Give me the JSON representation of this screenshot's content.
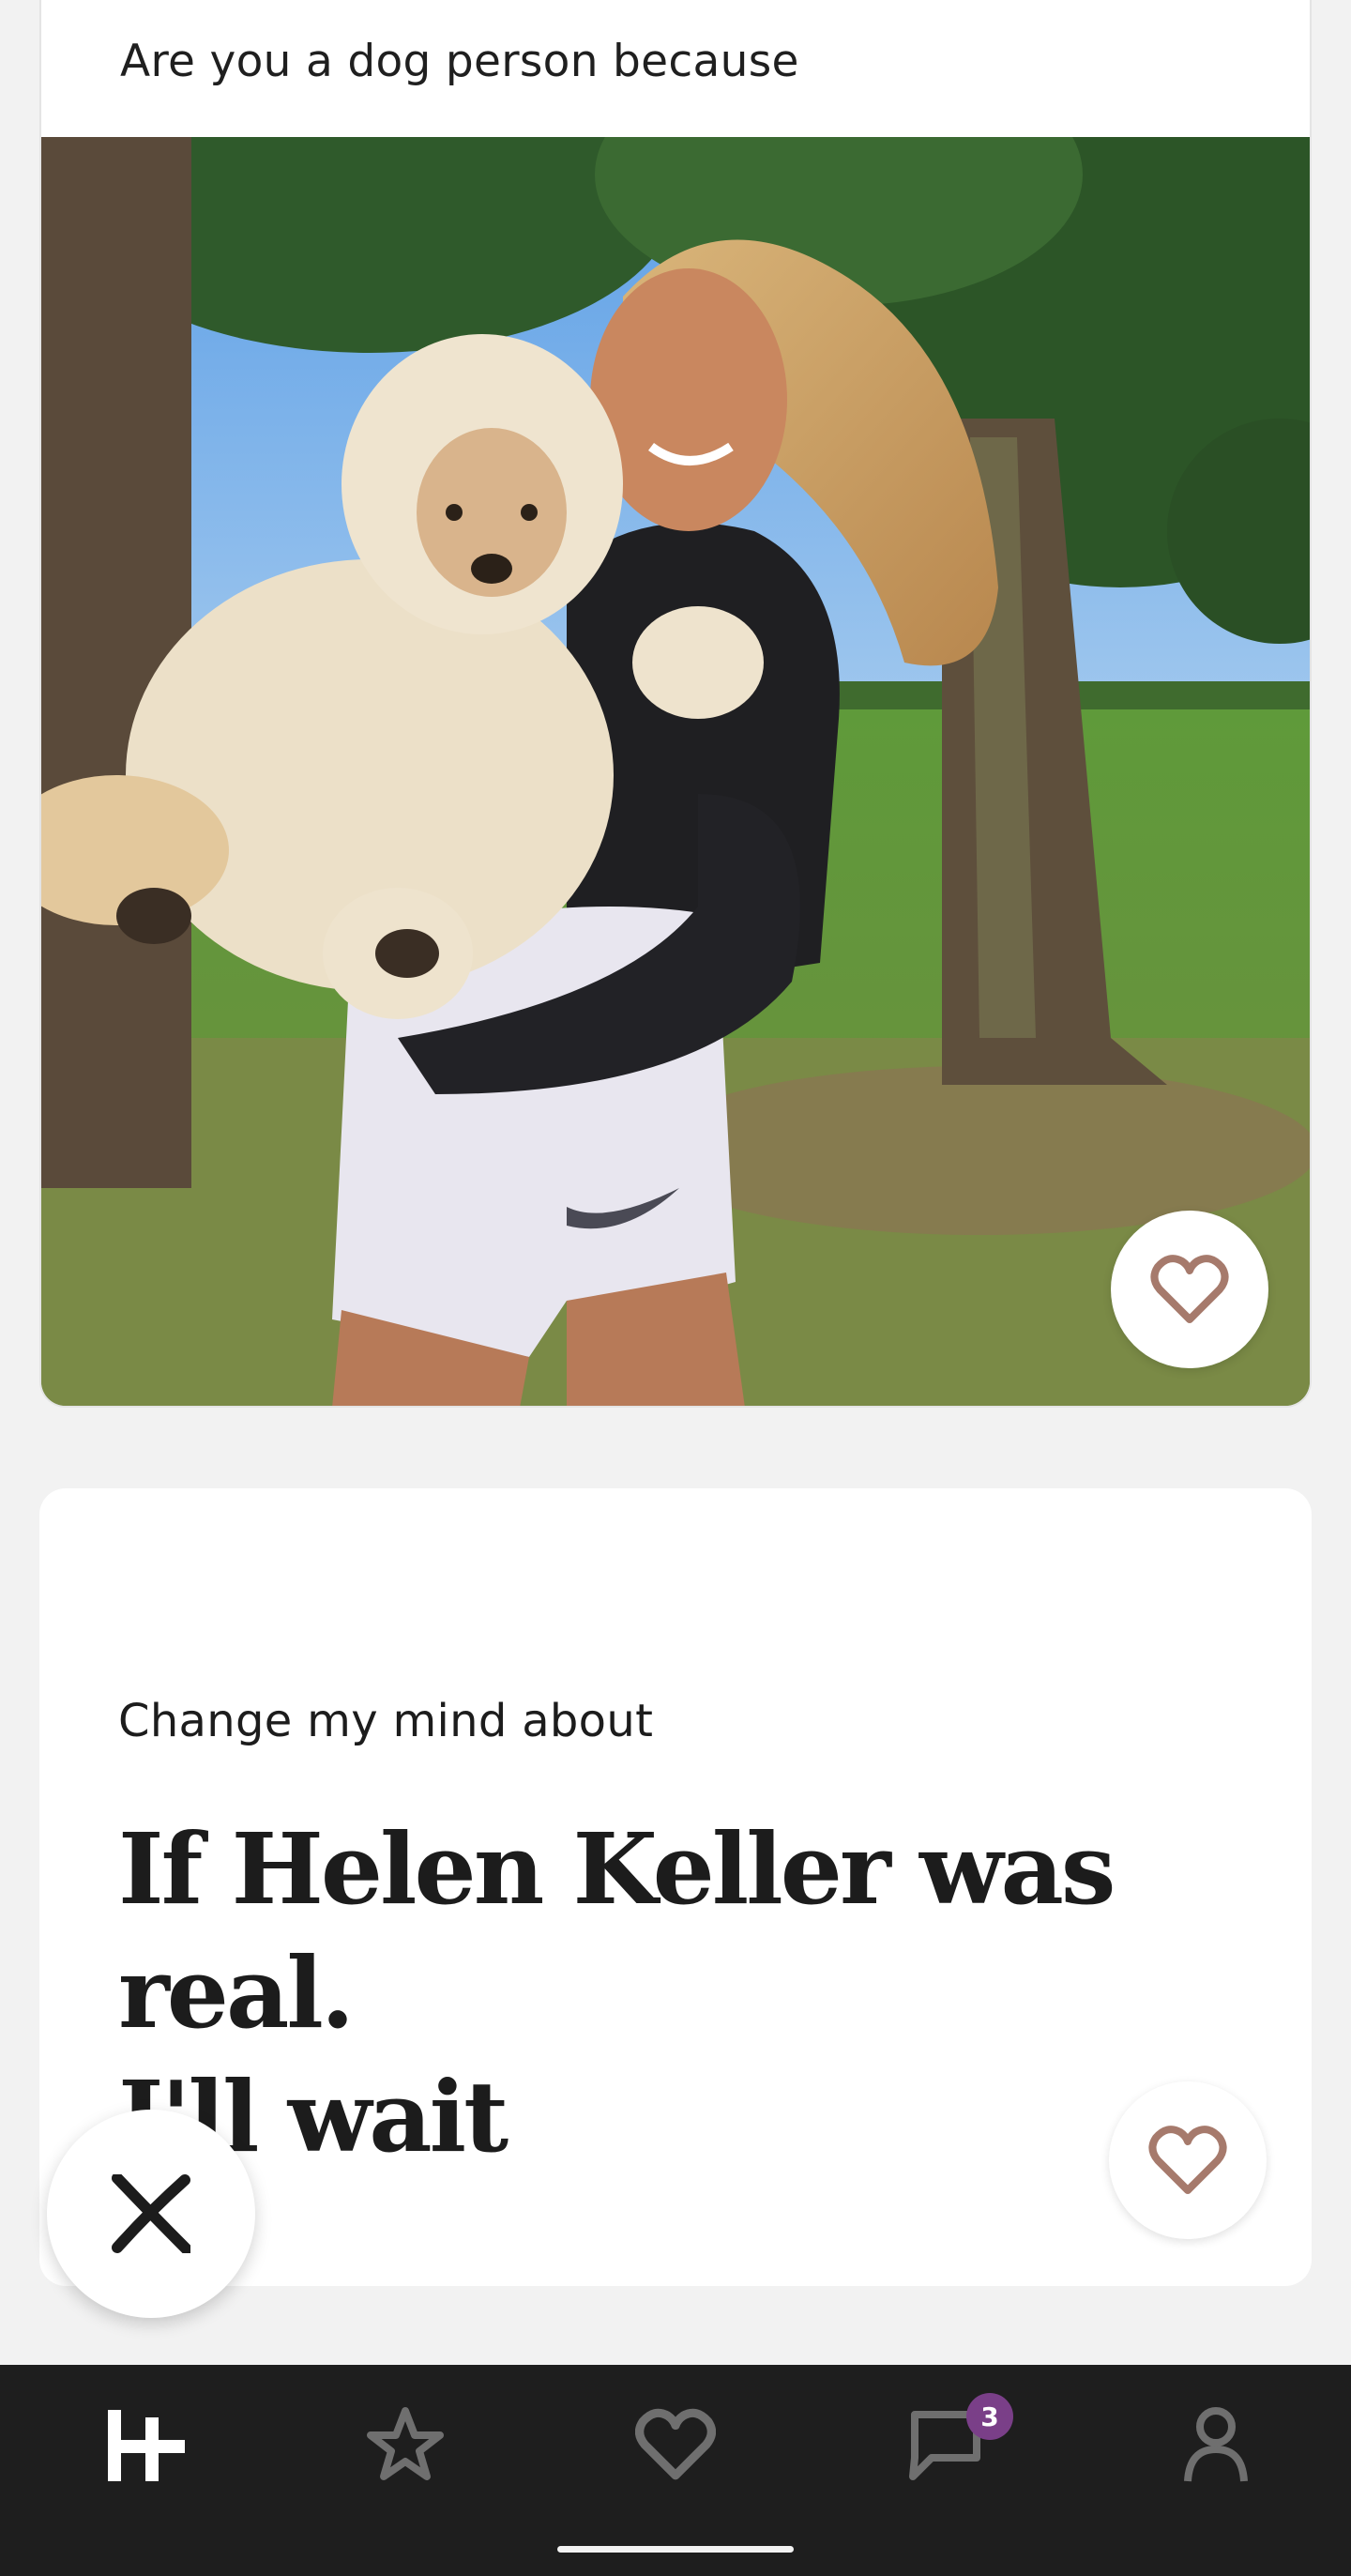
{
  "photo_card": {
    "caption": "Are you a dog person because",
    "like_icon": "heart-outline-icon"
  },
  "prompt_card": {
    "label": "Change my mind about",
    "answer_line1": "If Helen Keller was real.",
    "answer_line2": "I'll wait",
    "like_icon": "heart-outline-icon"
  },
  "skip_button": {
    "icon": "close-x-icon"
  },
  "nav": {
    "items": [
      {
        "icon": "hinge-logo-icon",
        "active": true
      },
      {
        "icon": "star-icon",
        "active": false
      },
      {
        "icon": "heart-icon",
        "active": false
      },
      {
        "icon": "chat-icon",
        "active": false
      },
      {
        "icon": "profile-icon",
        "active": false
      }
    ],
    "messages_badge": "3"
  },
  "colors": {
    "background": "#f2f2f2",
    "card": "#ffffff",
    "heart_accent": "#a67a6c",
    "nav_background": "#1e1e1e",
    "nav_icon_inactive": "#6f6f6f",
    "badge": "#7a3f88"
  }
}
